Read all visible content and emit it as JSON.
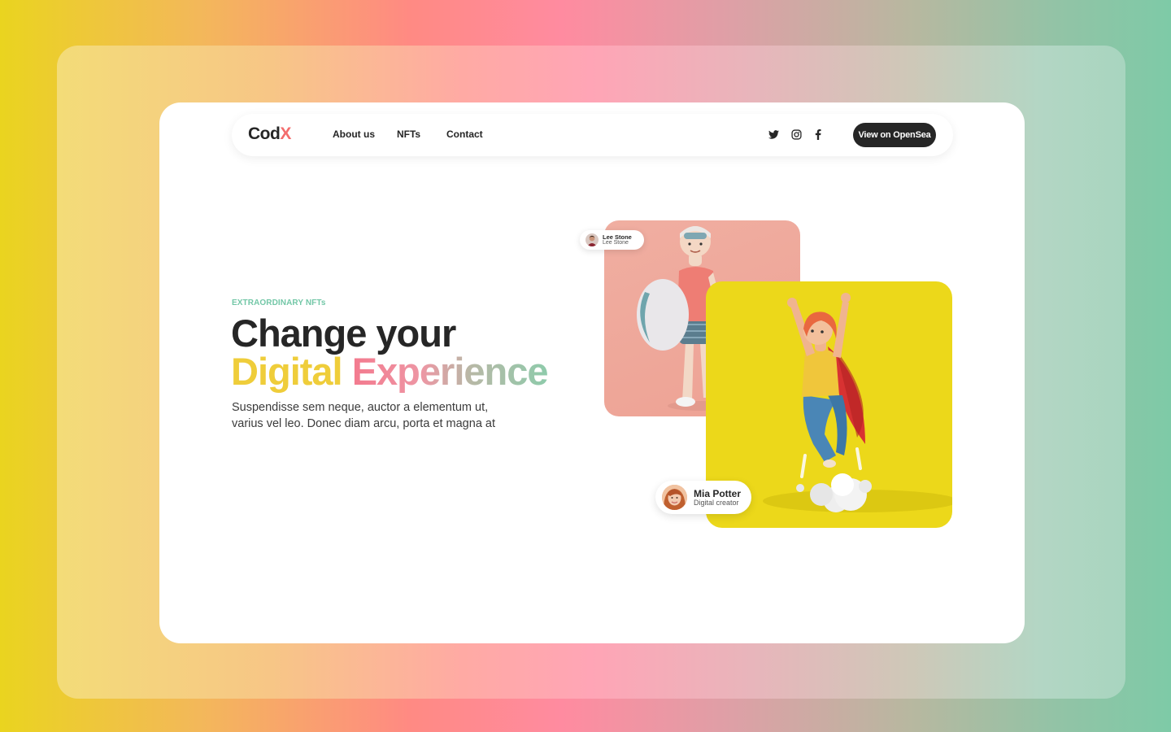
{
  "brand": {
    "logo_main": "Cod",
    "logo_accent": "X"
  },
  "nav": {
    "links": [
      "About us",
      "NFTs",
      "Contact"
    ],
    "social": [
      "twitter-icon",
      "instagram-icon",
      "facebook-icon"
    ],
    "cta_label": "View on OpenSea"
  },
  "hero": {
    "eyebrow": "EXTRAORDINARY NFTs",
    "title_line1": "Change your",
    "title_word1": "Digital",
    "title_word2": "Experience",
    "description_line1": "Suspendisse sem neque, auctor a elementum ut,",
    "description_line2": "varius vel leo. Donec diam arcu, porta et magna at"
  },
  "creators": [
    {
      "name": "Lee Stone",
      "role": "Lee Stone"
    },
    {
      "name": "Mia Potter",
      "role": "Digital creator"
    }
  ],
  "colors": {
    "accent_green": "#73c7a7",
    "accent_yellow": "#efcd3a",
    "accent_pink": "#f37a8e",
    "card_yellow": "#ecd81a",
    "card_pink": "#eda294",
    "dark": "#262626"
  }
}
